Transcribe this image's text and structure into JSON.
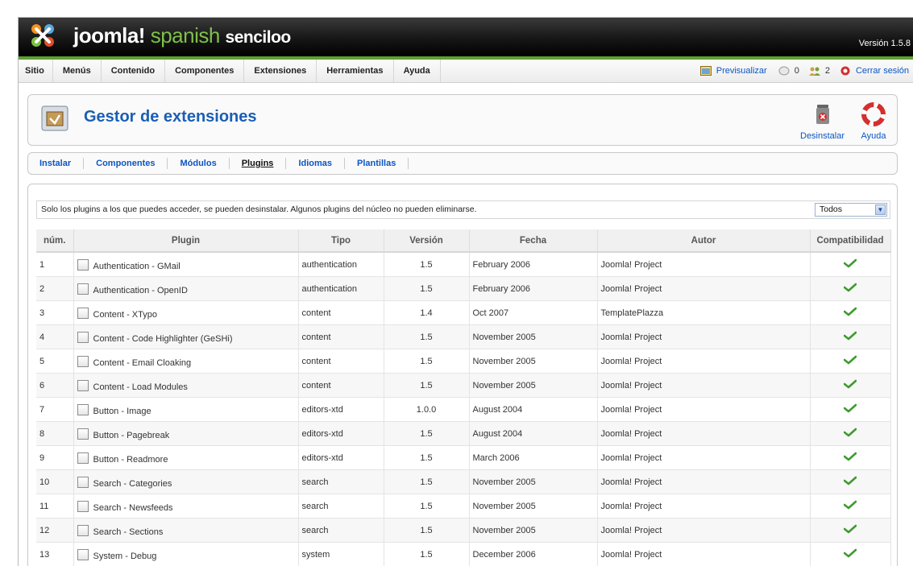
{
  "header": {
    "brand_joomla": "joomla!",
    "brand_spanish": "spanish",
    "brand_senciloo": "senciloo",
    "version": "Versión 1.5.8"
  },
  "menu": [
    {
      "label": "Sitio"
    },
    {
      "label": "Menús"
    },
    {
      "label": "Contenido"
    },
    {
      "label": "Componentes"
    },
    {
      "label": "Extensiones"
    },
    {
      "label": "Herramientas"
    },
    {
      "label": "Ayuda"
    }
  ],
  "status": {
    "preview": "Previsualizar",
    "messages_count": "0",
    "users_count": "2",
    "logout": "Cerrar sesión"
  },
  "toolbar": {
    "title": "Gestor de extensiones",
    "uninstall_label": "Desinstalar",
    "help_label": "Ayuda"
  },
  "submenu": [
    {
      "label": "Instalar",
      "active": false
    },
    {
      "label": "Componentes",
      "active": false
    },
    {
      "label": "Módulos",
      "active": false
    },
    {
      "label": "Plugins",
      "active": true
    },
    {
      "label": "Idiomas",
      "active": false
    },
    {
      "label": "Plantillas",
      "active": false
    }
  ],
  "notice": "Solo los plugins a los que puedes acceder, se pueden desinstalar. Algunos plugins del núcleo no pueden eliminarse.",
  "filter": {
    "selected": "Todos"
  },
  "table": {
    "columns": [
      "núm.",
      "Plugin",
      "Tipo",
      "Versión",
      "Fecha",
      "Autor",
      "Compatibilidad"
    ],
    "rows": [
      {
        "num": "1",
        "plugin": "Authentication - GMail",
        "type": "authentication",
        "version": "1.5",
        "date": "February 2006",
        "author": "Joomla! Project"
      },
      {
        "num": "2",
        "plugin": "Authentication - OpenID",
        "type": "authentication",
        "version": "1.5",
        "date": "February 2006",
        "author": "Joomla! Project"
      },
      {
        "num": "3",
        "plugin": "Content - XTypo",
        "type": "content",
        "version": "1.4",
        "date": "Oct 2007",
        "author": "TemplatePlazza"
      },
      {
        "num": "4",
        "plugin": "Content - Code Highlighter (GeSHi)",
        "type": "content",
        "version": "1.5",
        "date": "November 2005",
        "author": "Joomla! Project"
      },
      {
        "num": "5",
        "plugin": "Content - Email Cloaking",
        "type": "content",
        "version": "1.5",
        "date": "November 2005",
        "author": "Joomla! Project"
      },
      {
        "num": "6",
        "plugin": "Content - Load Modules",
        "type": "content",
        "version": "1.5",
        "date": "November 2005",
        "author": "Joomla! Project"
      },
      {
        "num": "7",
        "plugin": "Button - Image",
        "type": "editors-xtd",
        "version": "1.0.0",
        "date": "August 2004",
        "author": "Joomla! Project"
      },
      {
        "num": "8",
        "plugin": "Button - Pagebreak",
        "type": "editors-xtd",
        "version": "1.5",
        "date": "August 2004",
        "author": "Joomla! Project"
      },
      {
        "num": "9",
        "plugin": "Button - Readmore",
        "type": "editors-xtd",
        "version": "1.5",
        "date": "March 2006",
        "author": "Joomla! Project"
      },
      {
        "num": "10",
        "plugin": "Search - Categories",
        "type": "search",
        "version": "1.5",
        "date": "November 2005",
        "author": "Joomla! Project"
      },
      {
        "num": "11",
        "plugin": "Search - Newsfeeds",
        "type": "search",
        "version": "1.5",
        "date": "November 2005",
        "author": "Joomla! Project"
      },
      {
        "num": "12",
        "plugin": "Search - Sections",
        "type": "search",
        "version": "1.5",
        "date": "November 2005",
        "author": "Joomla! Project"
      },
      {
        "num": "13",
        "plugin": "System - Debug",
        "type": "system",
        "version": "1.5",
        "date": "December 2006",
        "author": "Joomla! Project"
      }
    ]
  },
  "colors": {
    "accent": "#0b55c4",
    "title": "#1a5fb4",
    "header_bar": "#5fa035",
    "check": "#3f9a2f"
  }
}
